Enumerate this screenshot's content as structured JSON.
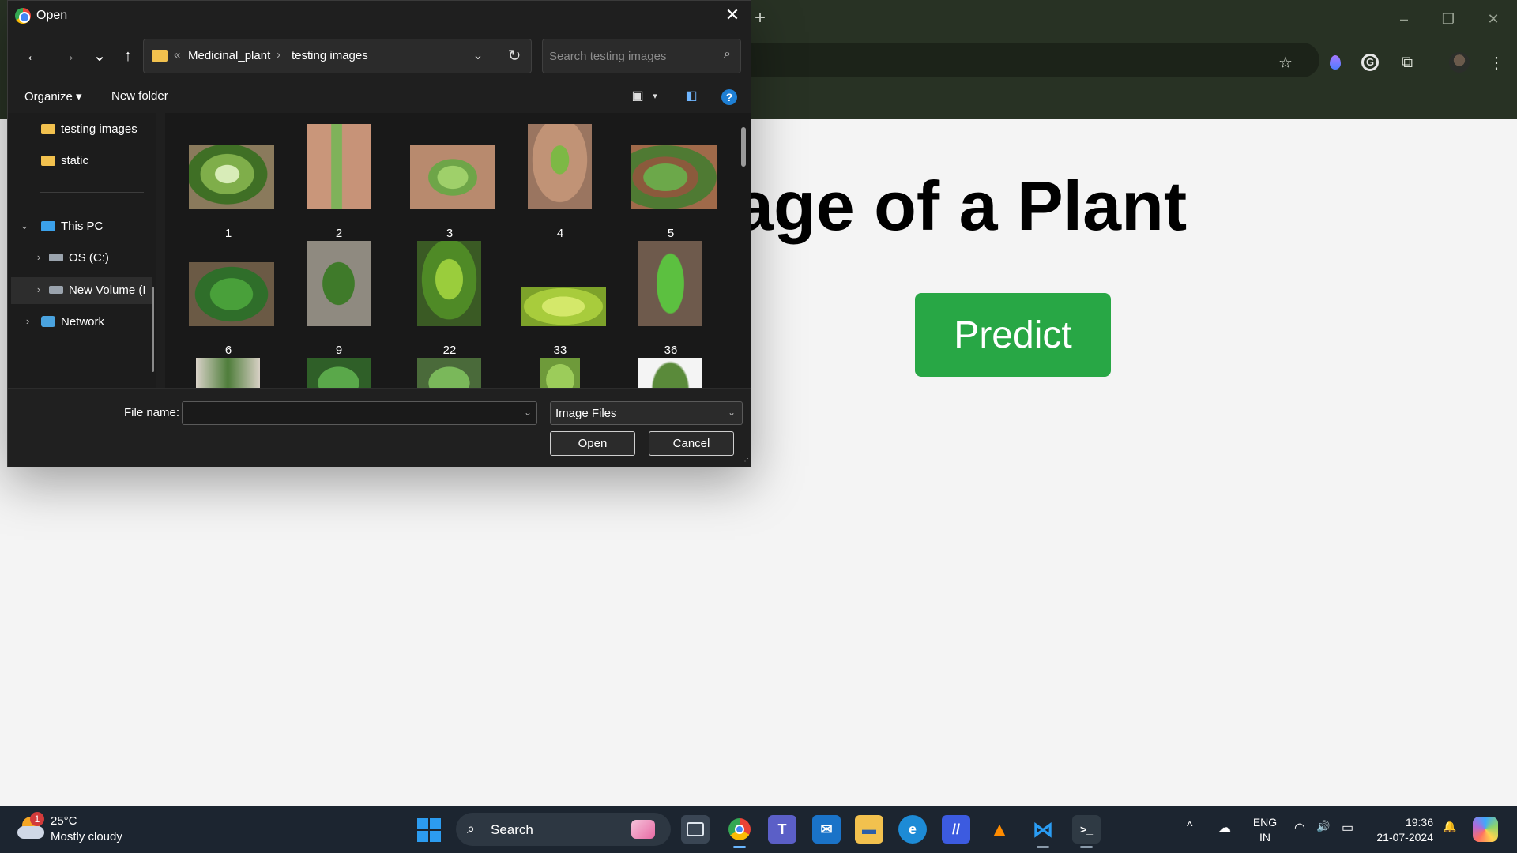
{
  "browser": {
    "new_tab": "+",
    "minimize": "–",
    "restore": "❐",
    "close": "✕",
    "toolbar_icons": [
      "star-icon",
      "extension-flame-icon",
      "grammarly-icon",
      "puzzle-icon",
      "profile-avatar",
      "more-icon"
    ]
  },
  "page": {
    "heading": "age of a Plant",
    "predict_button": "Predict",
    "colors": {
      "predict": "#28a745",
      "background": "#f4f4f4"
    }
  },
  "dialog": {
    "title": "Open",
    "close": "✕",
    "nav": {
      "back": "←",
      "forward": "→",
      "recent": "⌄",
      "up": "↑"
    },
    "address": {
      "overflow": "«",
      "crumbs": [
        "Medicinal_plant",
        "testing images"
      ],
      "separator": "›",
      "dropdown": "⌄",
      "refresh": "↻"
    },
    "search": {
      "placeholder": "Search testing images",
      "icon": "⌕"
    },
    "commands": {
      "organize": "Organize ▾",
      "new_folder": "New folder",
      "view": "▣",
      "view_more": "▾",
      "preview_pane": "◧",
      "help": "?"
    },
    "nav_pane": {
      "testing_images": "testing images",
      "static": "static",
      "this_pc": "This PC",
      "os_c": "OS (C:)",
      "new_volume": "New Volume (I",
      "network": "Network",
      "expand_down": "⌄",
      "expand_right": "›"
    },
    "files": [
      {
        "name": "1"
      },
      {
        "name": "2"
      },
      {
        "name": "3"
      },
      {
        "name": "4"
      },
      {
        "name": "5"
      },
      {
        "name": "6"
      },
      {
        "name": "9"
      },
      {
        "name": "22"
      },
      {
        "name": "33"
      },
      {
        "name": "36"
      }
    ],
    "bottom": {
      "file_name_label": "File name:",
      "file_name_value": "",
      "file_type": "Image Files",
      "open": "Open",
      "cancel": "Cancel",
      "chevron": "⌄"
    }
  },
  "taskbar": {
    "weather": {
      "badge": "1",
      "temp": "25°C",
      "desc": "Mostly cloudy"
    },
    "search": "Search",
    "apps": [
      "task-view",
      "chrome",
      "teams",
      "mail",
      "file-explorer",
      "edge",
      "ms-store",
      "vlc",
      "vscode",
      "terminal"
    ],
    "tray": {
      "chevron": "^",
      "cloud": "☁",
      "lang_line1": "ENG",
      "lang_line2": "IN",
      "wifi": "◠",
      "volume": "🔊",
      "battery": "▭",
      "bell": "🔔"
    },
    "clock": {
      "time": "19:36",
      "date": "21-07-2024"
    }
  }
}
